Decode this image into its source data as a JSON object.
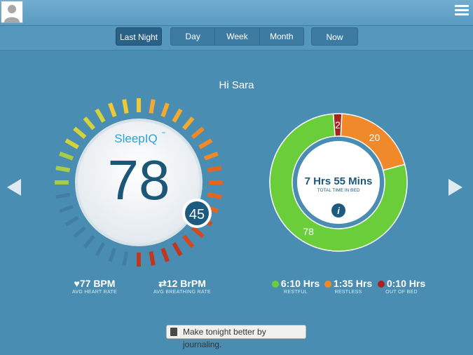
{
  "nav": {
    "last_night": "Last Night",
    "day": "Day",
    "week": "Week",
    "month": "Month",
    "now": "Now"
  },
  "greeting": "Hi Sara",
  "sleepiq": {
    "brand": "SleepIQ",
    "tm": "™",
    "score": "78",
    "badge": "45"
  },
  "vitals": {
    "heart_rate": "77 BPM",
    "heart_label": "AVG HEART RATE",
    "breathing_rate": "12 BrPM",
    "breathing_label": "AVG BREATHING RATE"
  },
  "donut": {
    "total_time": "7 Hrs 55 Mins",
    "total_label": "TOTAL TIME IN BED",
    "info": "i",
    "segments": [
      {
        "label": "78",
        "value": 78,
        "color": "#6acd3a"
      },
      {
        "label": "20",
        "value": 20,
        "color": "#f0892a"
      },
      {
        "label": "2",
        "value": 2,
        "color": "#a92220"
      }
    ]
  },
  "legend": {
    "restful_value": "6:10 Hrs",
    "restful_label": "RESTFUL",
    "restless_value": "1:35 Hrs",
    "restless_label": "RESTLESS",
    "out_value": "0:10 Hrs",
    "out_label": "OUT OF BED"
  },
  "journal": "Make tonight better by journaling.",
  "colors": {
    "restful": "#6acd3a",
    "restless": "#f0892a",
    "out_of_bed": "#a92220"
  }
}
